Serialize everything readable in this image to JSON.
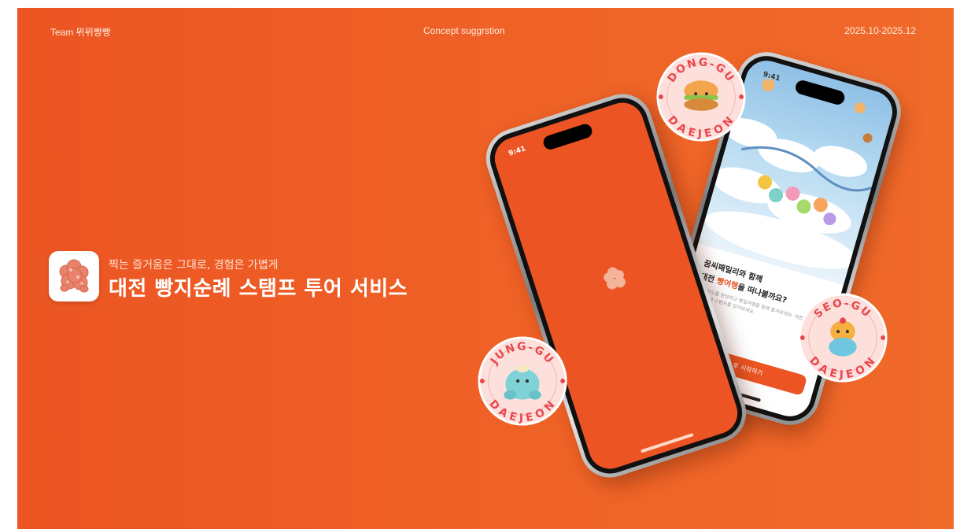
{
  "header": {
    "team": "Team 뮈뮈빵빵",
    "concept": "Concept suggrstion",
    "period": "2025.10-2025.12"
  },
  "hero": {
    "subtitle": "찍는 즐거움은 그대로, 경험은 가볍게",
    "title": "대전 빵지순례 스탬프 투어 서비스"
  },
  "phone_splash": {
    "status_time": "9:41"
  },
  "phone_onboarding": {
    "status_time": "9:41",
    "heading_line1": "꿈씨패밀리와 함께",
    "heading_accent": "빵여행",
    "heading_line2_rest": "을 떠나볼까요?",
    "body_text": "내 빵지도를 완성하고 빵집여행을 함께 즐겨보세요. 대전의 빵맛집을 찾아 스탬프를 모아보세요.",
    "cta_label": "등록 후 시작하기"
  },
  "badges": {
    "dong_top": "DONG-GU",
    "dong_bottom": "DAEJEON",
    "jung_top": "JUNG-GU",
    "jung_bottom": "DAEJEON",
    "seo_top": "SEO-GU",
    "seo_bottom": "DAEJEON"
  },
  "colors": {
    "brand_orange": "#ec5523",
    "badge_fill": "#fde0dc",
    "badge_text": "#e8474d"
  }
}
